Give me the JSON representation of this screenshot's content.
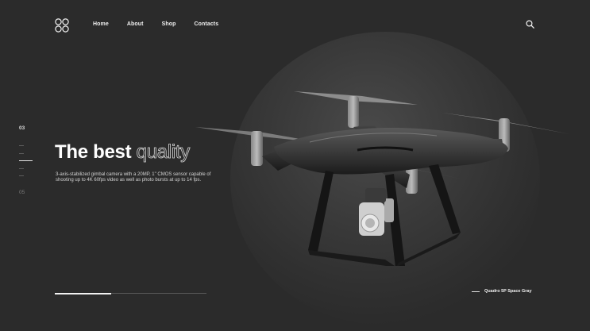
{
  "nav": {
    "items": [
      {
        "label": "Home"
      },
      {
        "label": "About"
      },
      {
        "label": "Shop"
      },
      {
        "label": "Contacts"
      }
    ]
  },
  "slides": {
    "current": "03",
    "total": "05",
    "active_index": 3,
    "tick_count": 5
  },
  "hero": {
    "title_solid": "The best",
    "title_outline": "quality",
    "description": "3-axis-stabilized gimbal camera with a 20MP, 1\" CMOS sensor capable of shooting up to 4K 60fps video as well as photo bursts at up to 14 fps."
  },
  "progress": {
    "fraction": 0.37
  },
  "product": {
    "caption": "Quadro 5P Space Gray"
  },
  "icons": {
    "logo": "four-circles-logo-icon",
    "search": "search-icon"
  },
  "colors": {
    "background": "#2b2b2b",
    "text": "#ffffff",
    "muted": "#7a7a7a"
  }
}
